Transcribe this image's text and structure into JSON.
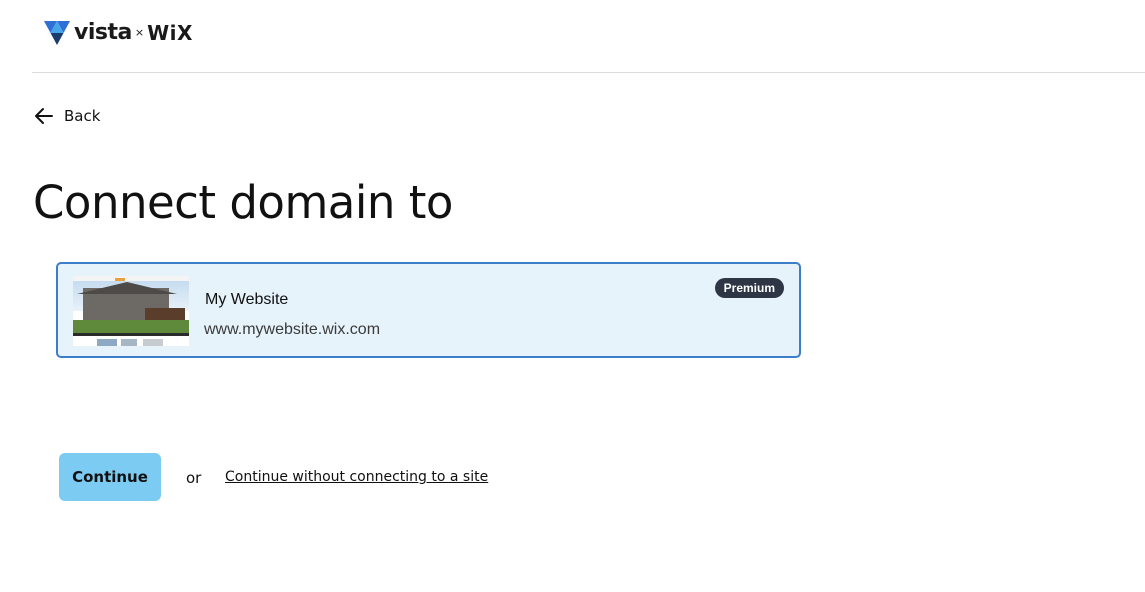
{
  "header": {
    "brand": "vista",
    "separator": "×",
    "partner": "WiX"
  },
  "nav": {
    "back_label": "Back"
  },
  "page": {
    "title": "Connect domain to"
  },
  "site_card": {
    "name": "My Website",
    "url": "www.mywebsite.wix.com",
    "badge": "Premium",
    "selected": true
  },
  "actions": {
    "continue_label": "Continue",
    "or_text": "or",
    "skip_link_label": "Continue without connecting to a site"
  },
  "colors": {
    "accent_border": "#3d7ec8",
    "card_background": "#e6f3fb",
    "continue_button": "#7ccbf2",
    "badge_background": "#2e3545"
  },
  "icons": {
    "logo": "vista-logo-icon",
    "back": "arrow-left-icon"
  }
}
